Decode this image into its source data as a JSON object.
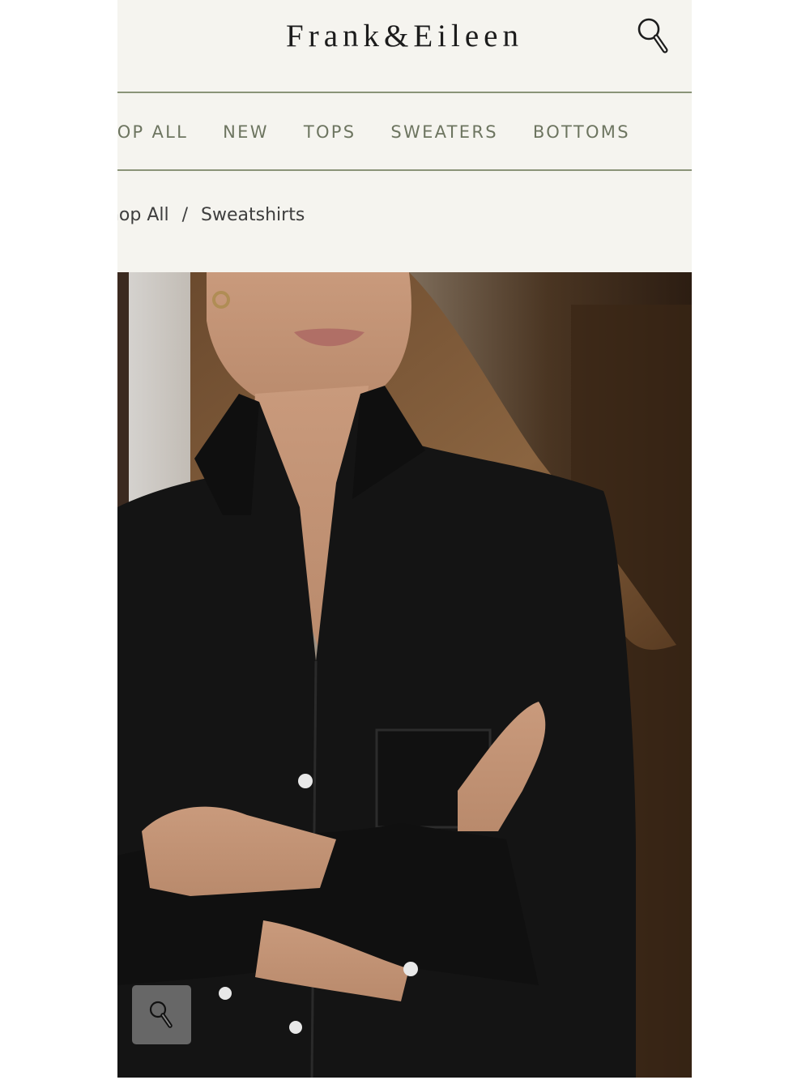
{
  "header": {
    "brand": "Frank&Eileen",
    "search_icon": "search-icon"
  },
  "nav": {
    "items": [
      {
        "label": "SHOP ALL"
      },
      {
        "label": "NEW"
      },
      {
        "label": "TOPS"
      },
      {
        "label": "SWEATERS"
      },
      {
        "label": "BOTTOMS"
      }
    ]
  },
  "breadcrumb": {
    "items": [
      {
        "label": "Shop All"
      },
      {
        "label": "Sweatshirts"
      }
    ],
    "separator": "/"
  },
  "product_image": {
    "description_icon": "product-photo",
    "zoom_icon": "zoom-icon"
  },
  "colors": {
    "background": "#f5f4ef",
    "nav_text": "#6d7560",
    "divider": "#8a9478",
    "garment": "#141414"
  }
}
